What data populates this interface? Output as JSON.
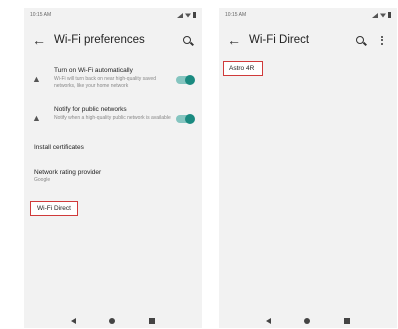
{
  "left_screen": {
    "status": {
      "time": "10:15 AM"
    },
    "title": "Wi-Fi preferences",
    "items": [
      {
        "title": "Turn on Wi-Fi automatically",
        "subtitle": "Wi-Fi will turn back on near high-quality saved networks, like your home network",
        "toggle_on": true
      },
      {
        "title": "Notify for public networks",
        "subtitle": "Notify when a high-quality public network is available",
        "toggle_on": true
      }
    ],
    "install_certificates": "Install certificates",
    "network_rating": {
      "title": "Network rating provider",
      "subtitle": "Google"
    },
    "wifi_direct": "Wi-Fi Direct"
  },
  "right_screen": {
    "status": {
      "time": "10:15 AM"
    },
    "title": "Wi-Fi Direct",
    "device": "Astro 4R"
  },
  "colors": {
    "accent": "#1a8a80",
    "highlight_border": "#d03a3a",
    "background": "#f2f2f2"
  },
  "icons": {
    "back": "arrow-back-icon",
    "search": "search-icon",
    "more": "more-vert-icon"
  }
}
